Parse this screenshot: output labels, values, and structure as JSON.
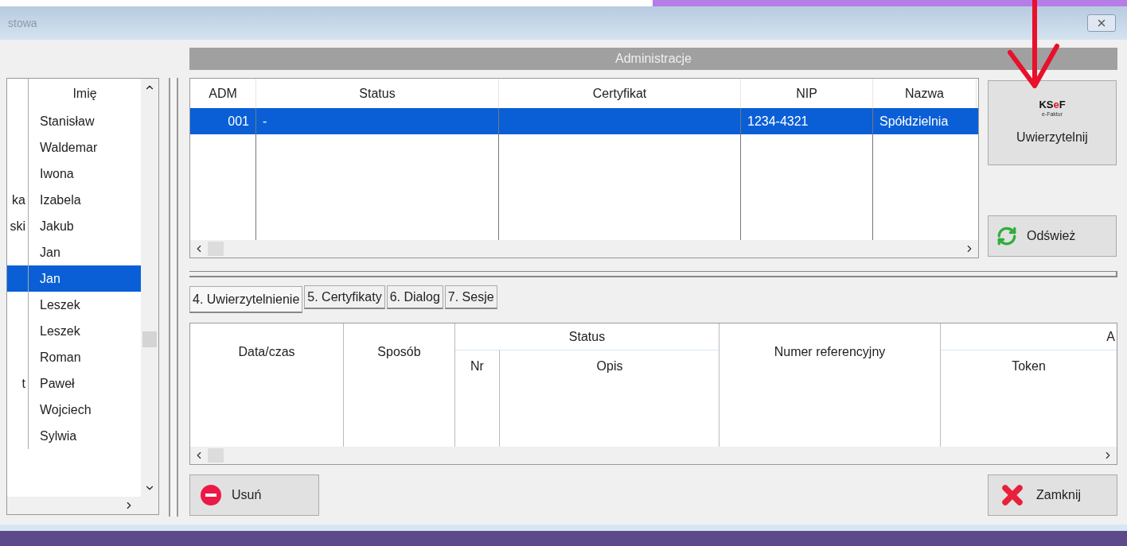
{
  "window": {
    "title": "stowa"
  },
  "people_list": {
    "header": "Imię",
    "rows": [
      {
        "first_name": "Stanisław",
        "selected": false
      },
      {
        "first_name": "Waldemar",
        "selected": false
      },
      {
        "first_name": "Iwona",
        "selected": false
      },
      {
        "surname": "ka",
        "first_name": "Izabela",
        "selected": false
      },
      {
        "surname": "ski",
        "first_name": "Jakub",
        "selected": false
      },
      {
        "first_name": "Jan",
        "selected": false
      },
      {
        "first_name": "Jan",
        "selected": true
      },
      {
        "first_name": "Leszek",
        "selected": false
      },
      {
        "first_name": "Leszek",
        "selected": false
      },
      {
        "first_name": "Roman",
        "selected": false
      },
      {
        "surname": "t",
        "first_name": "Paweł",
        "selected": false
      },
      {
        "first_name": "Wojciech",
        "selected": false
      },
      {
        "first_name": "Sylwia",
        "selected": false
      }
    ]
  },
  "administration": {
    "title": "Administracje",
    "columns": [
      "ADM",
      "Status",
      "Certyfikat",
      "NIP",
      "Nazwa"
    ],
    "rows": [
      {
        "adm": "001",
        "status": "-",
        "nip": "1234-4321",
        "nazwa": "Spółdzielnia",
        "selected": true
      }
    ]
  },
  "side_buttons": [
    {
      "kind": "ksef",
      "logo_parts": [
        {
          "text": "KS",
          "color": "#111111"
        },
        {
          "text": "e",
          "color": "#e3122d"
        },
        {
          "text": "F",
          "color": "#111111"
        }
      ],
      "logo_subtitle": "e-Faktur",
      "label": "Uwierzytelnij"
    },
    {
      "kind": "refresh",
      "label": "Odśwież"
    }
  ],
  "tabs": [
    {
      "label": "4. Uwierzytelnienie",
      "selected": true
    },
    {
      "label": "5. Certyfikaty",
      "selected": false
    },
    {
      "label": "6. Dialog",
      "selected": false
    },
    {
      "label": "7. Sesje",
      "selected": false
    }
  ],
  "detail_table": {
    "columns": [
      {
        "label": "Data/czas"
      },
      {
        "label": "Sposób"
      },
      {
        "label": "Status",
        "children": [
          {
            "label": "Nr"
          },
          {
            "label": "Opis"
          }
        ]
      },
      {
        "label": "Numer referencyjny"
      },
      {
        "label": "A",
        "children": [
          {
            "label": "Token"
          }
        ]
      }
    ]
  },
  "bottom_buttons": [
    {
      "kind": "delete",
      "label": "Usuń"
    },
    {
      "kind": "close",
      "label": "Zamknij"
    }
  ]
}
